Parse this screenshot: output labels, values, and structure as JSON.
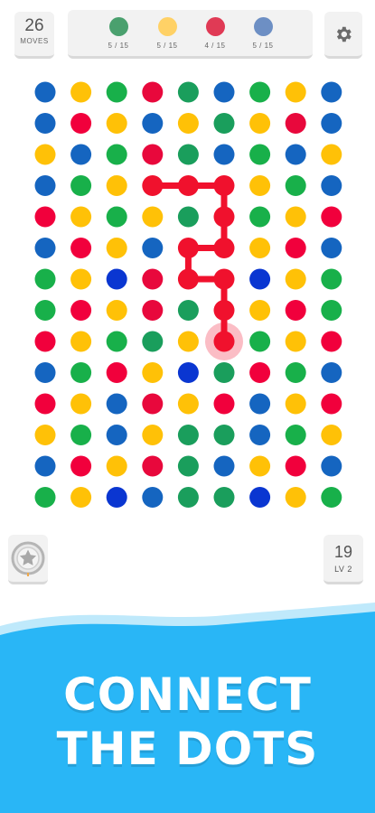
{
  "header": {
    "moves": {
      "value": "26",
      "label": "MOVES"
    },
    "goals": [
      {
        "color": "#4aa06e",
        "progress": "5 / 15"
      },
      {
        "color": "#ffd166",
        "progress": "5 / 15"
      },
      {
        "color": "#e03a55",
        "progress": "4 / 15"
      },
      {
        "color": "#6d8fc4",
        "progress": "5 / 15"
      }
    ],
    "settings_icon": "gear-icon"
  },
  "palette": {
    "B": "#1565c0",
    "Y": "#ffc107",
    "G": "#18b04a",
    "R": "#f1003c",
    "E": "#1a9e5c",
    "N": "#0a36d1",
    "S": "#e8083c",
    "path": "#f0112d",
    "selection_halo": "rgba(240,17,45,0.28)"
  },
  "board": {
    "rows": [
      [
        "B",
        "Y",
        "G",
        "S",
        "E",
        "B",
        "G",
        "Y",
        "B"
      ],
      [
        "B",
        "R",
        "Y",
        "B",
        "Y",
        "E",
        "Y",
        "S",
        "B"
      ],
      [
        "Y",
        "B",
        "G",
        "S",
        "E",
        "B",
        "G",
        "B",
        "Y"
      ],
      [
        "B",
        "G",
        "Y",
        "R",
        "R",
        "R",
        "Y",
        "G",
        "B"
      ],
      [
        "R",
        "Y",
        "G",
        "Y",
        "E",
        "R",
        "G",
        "Y",
        "R"
      ],
      [
        "B",
        "R",
        "Y",
        "B",
        "R",
        "R",
        "Y",
        "R",
        "B"
      ],
      [
        "G",
        "Y",
        "N",
        "S",
        "R",
        "R",
        "N",
        "Y",
        "G"
      ],
      [
        "G",
        "R",
        "Y",
        "S",
        "E",
        "R",
        "Y",
        "R",
        "G"
      ],
      [
        "R",
        "Y",
        "G",
        "E",
        "Y",
        "R",
        "G",
        "Y",
        "R"
      ],
      [
        "B",
        "G",
        "R",
        "Y",
        "N",
        "E",
        "R",
        "G",
        "B"
      ],
      [
        "R",
        "Y",
        "B",
        "S",
        "Y",
        "R",
        "B",
        "Y",
        "R"
      ],
      [
        "Y",
        "G",
        "B",
        "Y",
        "E",
        "E",
        "B",
        "G",
        "Y"
      ],
      [
        "B",
        "R",
        "Y",
        "S",
        "E",
        "B",
        "Y",
        "R",
        "B"
      ],
      [
        "G",
        "Y",
        "N",
        "B",
        "E",
        "E",
        "N",
        "Y",
        "G"
      ]
    ],
    "path": [
      [
        3,
        3
      ],
      [
        3,
        4
      ],
      [
        3,
        5
      ],
      [
        4,
        5
      ],
      [
        5,
        5
      ],
      [
        5,
        4
      ],
      [
        6,
        4
      ],
      [
        6,
        5
      ],
      [
        7,
        5
      ],
      [
        8,
        5
      ]
    ],
    "selected": [
      8,
      5
    ]
  },
  "footer": {
    "powerup_icon": "star-badge-icon",
    "level_number": "19",
    "level_label": "LV 2"
  },
  "banner": {
    "line1": "CONNECT",
    "line2": "THE DOTS",
    "color": "#29b6f6"
  }
}
